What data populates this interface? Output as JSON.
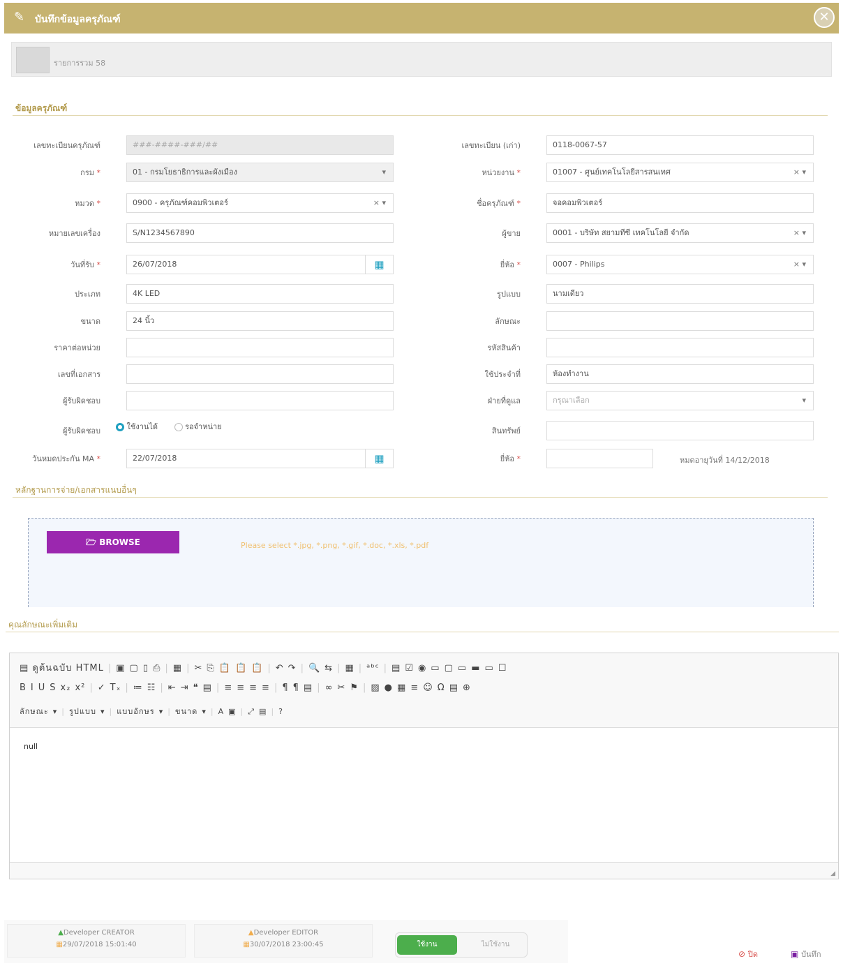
{
  "header": {
    "title": "บันทึกข้อมูลครุภัณฑ์"
  },
  "subbar": {
    "label": "รายการรวม 58"
  },
  "sections": {
    "info": "ข้อมูลครุภัณฑ์",
    "attachments": "หลักฐานการจ่าย/เอกสารแนบอื่นๆ",
    "notes": "คุณลักษณะเพิ่มเติม"
  },
  "left_fields": [
    {
      "label": "เลขทะเบียนครุภัณฑ์",
      "required": "",
      "value": "###-####-###/##",
      "kind": "readonly"
    },
    {
      "label": "กรม",
      "required": "*",
      "value": "01 - กรมโยธาธิการและผังเมือง",
      "kind": "select"
    },
    {
      "label": "หมวด",
      "required": "*",
      "value": "0900 - ครุภัณฑ์คอมพิวเตอร์",
      "kind": "clear"
    },
    {
      "label": "หมายเลขเครื่อง",
      "required": "",
      "value": "S/N1234567890",
      "kind": "text"
    },
    {
      "label": "วันที่รับ",
      "required": "*",
      "value": "26/07/2018",
      "kind": "date"
    },
    {
      "label": "ประเภท",
      "required": "",
      "value": "4K LED",
      "kind": "text"
    },
    {
      "label": "ขนาด",
      "required": "",
      "value": "24 นิ้ว",
      "kind": "text"
    },
    {
      "label": "ราคาต่อหน่วย",
      "required": "",
      "value": "",
      "kind": "text"
    },
    {
      "label": "เลขที่เอกสาร",
      "required": "",
      "value": "",
      "kind": "text"
    },
    {
      "label": "ผู้รับผิดชอบ",
      "required": "",
      "value": "",
      "kind": "text"
    }
  ],
  "status_row": {
    "label": "ผู้รับผิดชอบ",
    "option1": "ใช้งานได้",
    "option2": "รอจำหน่าย"
  },
  "left_last": {
    "label": "วันหมดประกัน MA",
    "required": "*",
    "value": "22/07/2018"
  },
  "right_fields": [
    {
      "label": "เลขทะเบียน (เก่า)",
      "required": "",
      "value": "0118-0067-57",
      "kind": "text"
    },
    {
      "label": "หน่วยงาน",
      "required": "*",
      "value": "01007 - ศูนย์เทคโนโลยีสารสนเทศ",
      "kind": "clear"
    },
    {
      "label": "ชื่อครุภัณฑ์",
      "required": "*",
      "value": "จอคอมพิวเตอร์",
      "kind": "text"
    },
    {
      "label": "ผู้ขาย",
      "required": "",
      "value": "0001 - บริษัท สยามทีซี เทคโนโลยี จำกัด",
      "kind": "clear"
    },
    {
      "label": "ยี่ห้อ",
      "required": "*",
      "value": "0007 - Philips",
      "kind": "clear"
    },
    {
      "label": "รูปแบบ",
      "required": "",
      "value": "นามเดียว",
      "kind": "text"
    },
    {
      "label": "ลักษณะ",
      "required": "",
      "value": "",
      "kind": "text"
    },
    {
      "label": "รหัสสินค้า",
      "required": "",
      "value": "",
      "kind": "text"
    },
    {
      "label": "ใช้ประจำที่",
      "required": "",
      "value": "ห้องทำงาน",
      "kind": "text"
    },
    {
      "label": "ฝ่ายที่ดูแล",
      "required": "",
      "value": "กรุณาเลือก",
      "kind": "select-ph"
    },
    {
      "label": "สินทรัพย์",
      "required": "",
      "value": "",
      "kind": "readonly-white"
    }
  ],
  "right_last": {
    "label": "ยี่ห้อ",
    "required": "*",
    "value": "",
    "note": "หมดอายุวันที่ 14/12/2018"
  },
  "upload": {
    "button": "BROWSE",
    "hint": "Please select *.jpg, *.png, *.gif, *.doc, *.xls, *.pdf"
  },
  "editor": {
    "row1": [
      "▤ ดูต้นฉบับ HTML",
      "|",
      "▣",
      "▢",
      "▯",
      "⎙",
      "|",
      "▦",
      "|",
      "✂",
      "⎘",
      "📋",
      "📋",
      "📋",
      "|",
      "↶",
      "↷",
      "|",
      "🔍",
      "⇆",
      "|",
      "▦",
      "|",
      "ᵃᵇᶜ",
      "|",
      "▤",
      "☑",
      "◉",
      "▭",
      "▢",
      "▭",
      "▬",
      "▭",
      "☐"
    ],
    "row2": [
      "B",
      "I",
      "U",
      "S",
      "x₂",
      "x²",
      "|",
      "✓",
      "Tₓ",
      "|",
      "≔",
      "☷",
      "|",
      "⇤",
      "⇥",
      "❝",
      "▤",
      "|",
      "≡",
      "≡",
      "≡",
      "≡",
      "|",
      "¶",
      "¶",
      "▤",
      "|",
      "∞",
      "✂",
      "⚑",
      "|",
      "▨",
      "●",
      "▦",
      "≡",
      "☺",
      "Ω",
      "▤",
      "⊕"
    ],
    "row3": [
      "ลักษณะ",
      "▾",
      "|",
      "รูปแบบ",
      "▾",
      "|",
      "แบบอักษร",
      "▾",
      "|",
      "ขนาด",
      "▾",
      "|",
      "A",
      "▣",
      "|",
      "⤢",
      "▤",
      "|",
      "?"
    ],
    "content": "null"
  },
  "footer": {
    "creator": "Developer CREATOR",
    "created": "29/07/2018 15:01:40",
    "editor": "Developer EDITOR",
    "edited": "30/07/2018 23:00:45",
    "toggle_on": "ใช้งาน",
    "toggle_off": "ไม่ใช้งาน",
    "cancel": "ปิด",
    "save": "บันทึก"
  },
  "colors": {
    "header": "#c6b370",
    "browse": "#9b27af",
    "toggle": "#4cae4c",
    "cancel": "#d9534f",
    "save": "#7b1fa2"
  }
}
